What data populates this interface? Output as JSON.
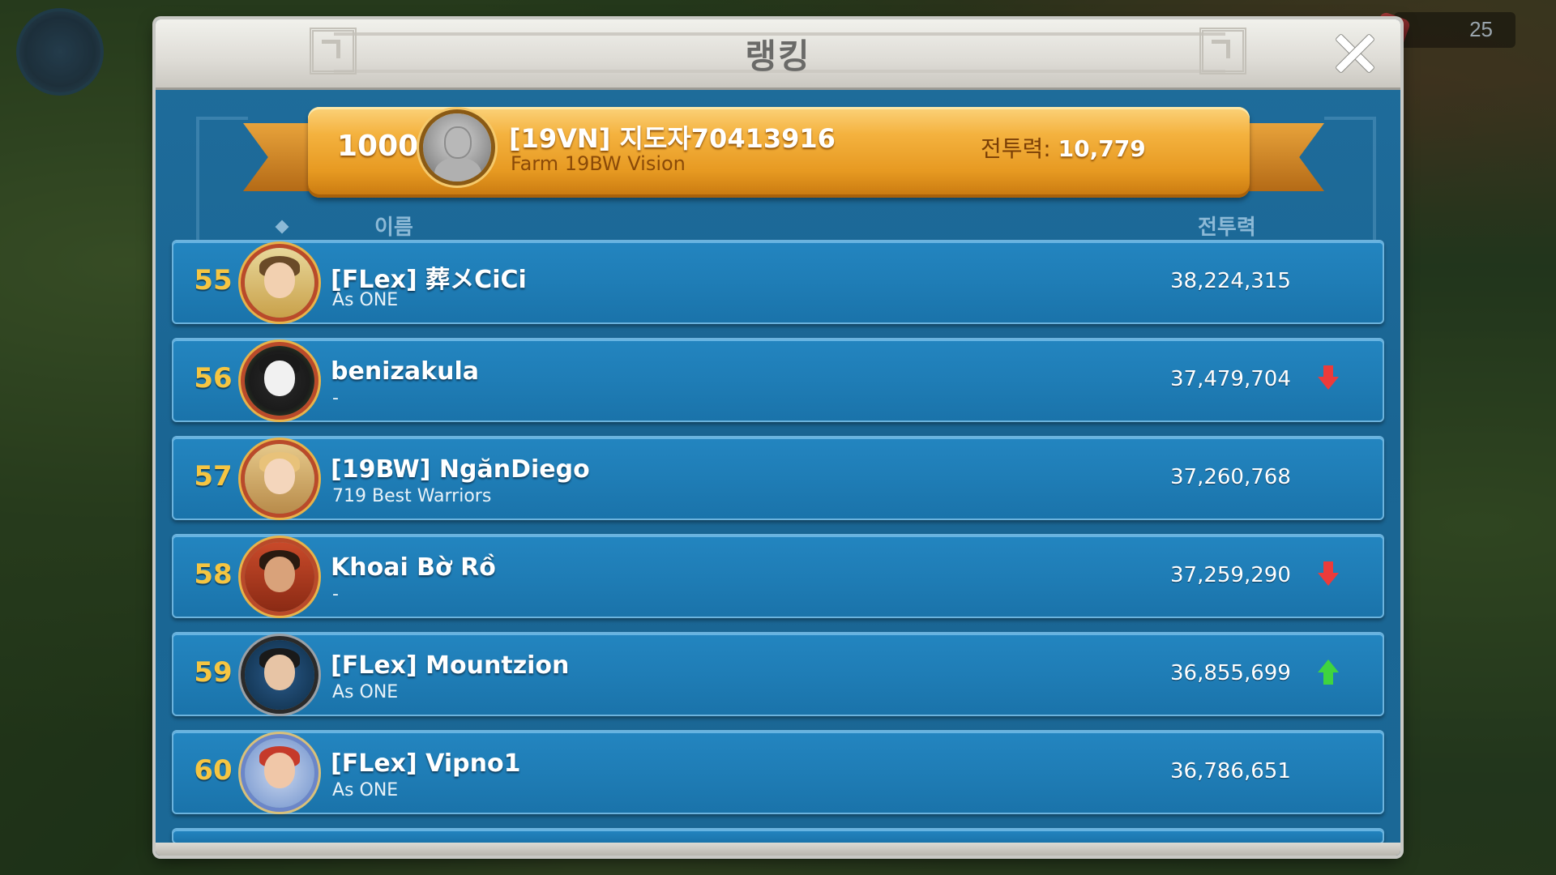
{
  "window": {
    "title": "랭킹"
  },
  "hud": {
    "counter": "25"
  },
  "my_entry": {
    "rank": "1000+",
    "name": "[19VN] 지도자70413916",
    "guild": "Farm 19BW Vision",
    "power_label": "전투력:",
    "power_value": "10,779"
  },
  "columns": {
    "name": "이름",
    "power": "전투력"
  },
  "rows": [
    {
      "rank": "55",
      "name": "[FLex] 葬メCiCi",
      "guild": "As ONE",
      "power": "38,224,315",
      "trend": "none"
    },
    {
      "rank": "56",
      "name": "benizakula",
      "guild": "-",
      "power": "37,479,704",
      "trend": "down"
    },
    {
      "rank": "57",
      "name": "[19BW] NgănDiego",
      "guild": "719 Best Warriors",
      "power": "37,260,768",
      "trend": "none"
    },
    {
      "rank": "58",
      "name": "Khoai Bờ Rồ",
      "guild": "-",
      "power": "37,259,290",
      "trend": "down"
    },
    {
      "rank": "59",
      "name": "[FLex] Mountzion",
      "guild": "As ONE",
      "power": "36,855,699",
      "trend": "up"
    },
    {
      "rank": "60",
      "name": "[FLex] Vipno1",
      "guild": "As ONE",
      "power": "36,786,651",
      "trend": "none"
    }
  ],
  "colors": {
    "panel_blue": "#1f6d9c",
    "rank_gold": "#f5c542",
    "trend_down": "#ec3b3b",
    "trend_up": "#3fd43f",
    "ribbon_gold": "#f4b23f"
  }
}
